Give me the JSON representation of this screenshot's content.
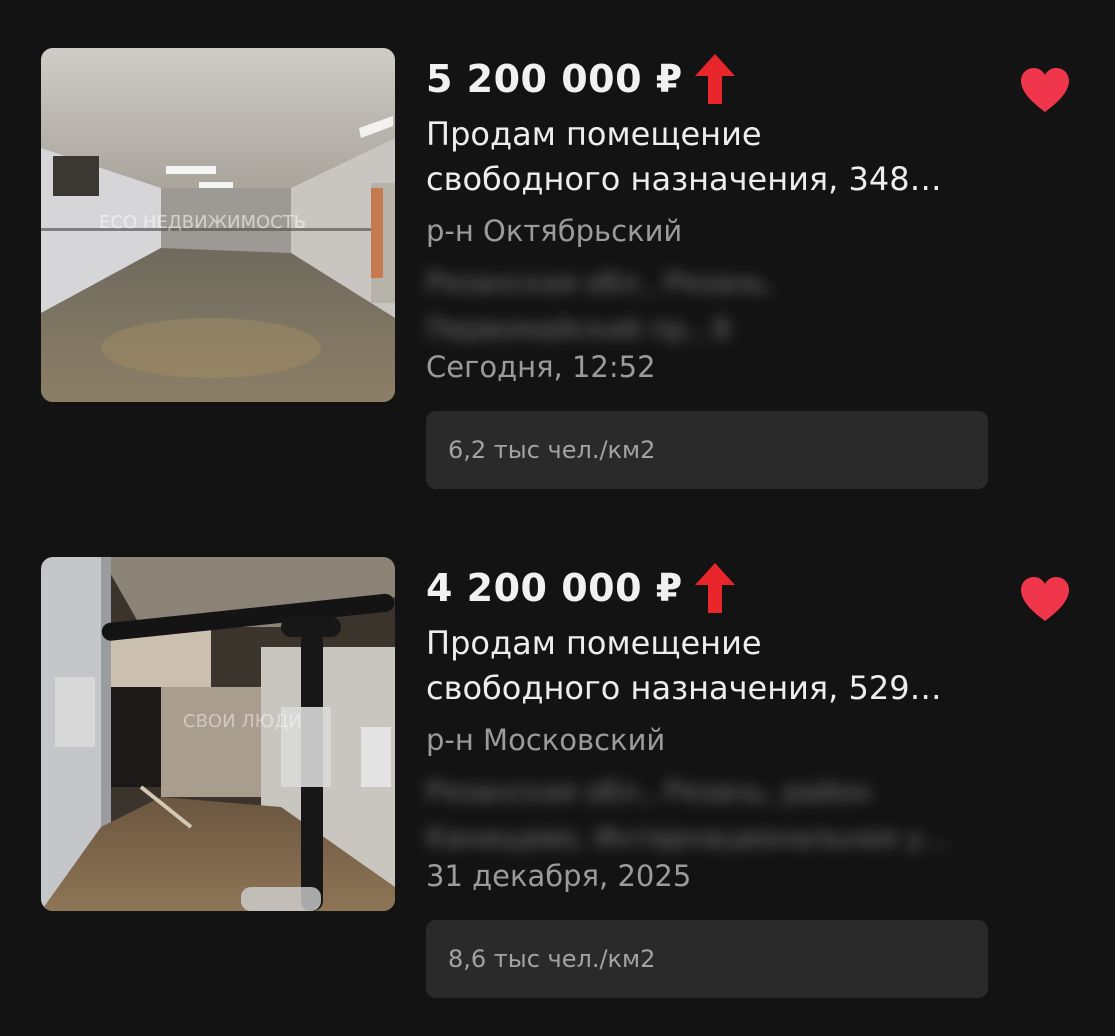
{
  "listings": [
    {
      "price": "5 200 000 ₽",
      "title_line1": "Продам помещение",
      "title_line2": "свободного назначения, 348…",
      "district": "р-н Октябрьский",
      "address_line1": "Рязанская обл., Рязань,",
      "address_line2": "Первомайский пр., 8",
      "date": "Сегодня, 12:52",
      "density": "6,2 тыс чел./км2",
      "photo_watermark": "ЕСО НЕДВИЖИМОСТЬ",
      "price_trend_icon": "arrow-up-icon",
      "favorite_icon": "heart-icon"
    },
    {
      "price": "4 200 000 ₽",
      "title_line1": "Продам помещение",
      "title_line2": "свободного назначения, 529…",
      "district": "р-н Московский",
      "address_line1": "Рязанская обл., Рязань, район",
      "address_line2": "Канищево, Интернациональная у…",
      "date": "31 декабря, 2025",
      "density": "8,6 тыс чел./км2",
      "photo_watermark": "СВОИ ЛЮДИ",
      "price_trend_icon": "arrow-up-icon",
      "favorite_icon": "heart-icon"
    }
  ],
  "colors": {
    "background": "#131313",
    "accent_red": "#f0364a",
    "arrow_red": "#e8262b",
    "chip_background": "#2a2a2a",
    "secondary_text": "#9b9b9b"
  }
}
